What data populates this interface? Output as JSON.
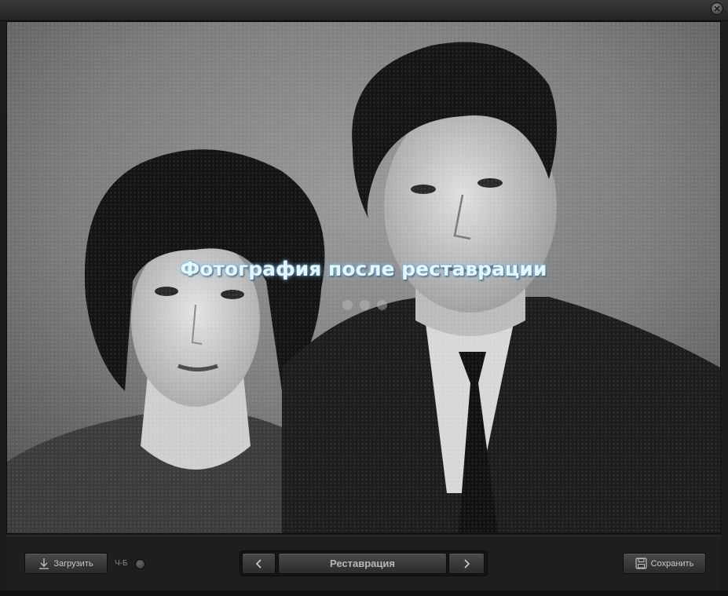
{
  "window": {
    "close_icon": "close-icon"
  },
  "photo": {
    "description_alt": "",
    "caption": "Фотография после реставрации"
  },
  "toolbar": {
    "load_label": "Загрузить",
    "load_icon": "download-icon",
    "bw_label": "Ч-Б",
    "mode_label": "Реставрация",
    "prev_icon": "chevron-left-icon",
    "next_icon": "chevron-right-icon",
    "save_label": "Сохранить",
    "save_icon": "floppy-disk-icon"
  },
  "colors": {
    "caption_text": "#e7f7ff",
    "caption_glow": "#8fd0ff",
    "chrome_dark": "#1e1e1e",
    "button_top": "#4a4a4a",
    "button_bottom": "#2b2b2b"
  }
}
